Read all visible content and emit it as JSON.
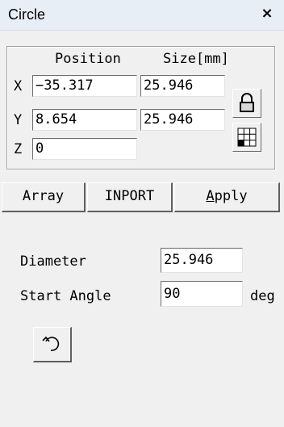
{
  "window": {
    "title": "Circle",
    "close_glyph": "×"
  },
  "transform": {
    "header_position": "Position",
    "header_size": "Size[mm]",
    "rows": [
      {
        "axis": "X",
        "position": "−35.317",
        "size": "25.946"
      },
      {
        "axis": "Y",
        "position": "8.654",
        "size": "25.946"
      },
      {
        "axis": "Z",
        "position": "0"
      }
    ],
    "lock_icon": "lock-icon",
    "grid_icon": "anchor-grid-icon"
  },
  "buttons": {
    "array": "Array",
    "import": "INPORT",
    "apply_underlined": "A",
    "apply_rest": "pply"
  },
  "circle": {
    "diameter_label": "Diameter",
    "diameter_value": "25.946",
    "start_angle_label": "Start Angle",
    "start_angle_value": "90",
    "start_angle_unit": "deg",
    "direction_icon": "rotate-clockwise-icon"
  }
}
